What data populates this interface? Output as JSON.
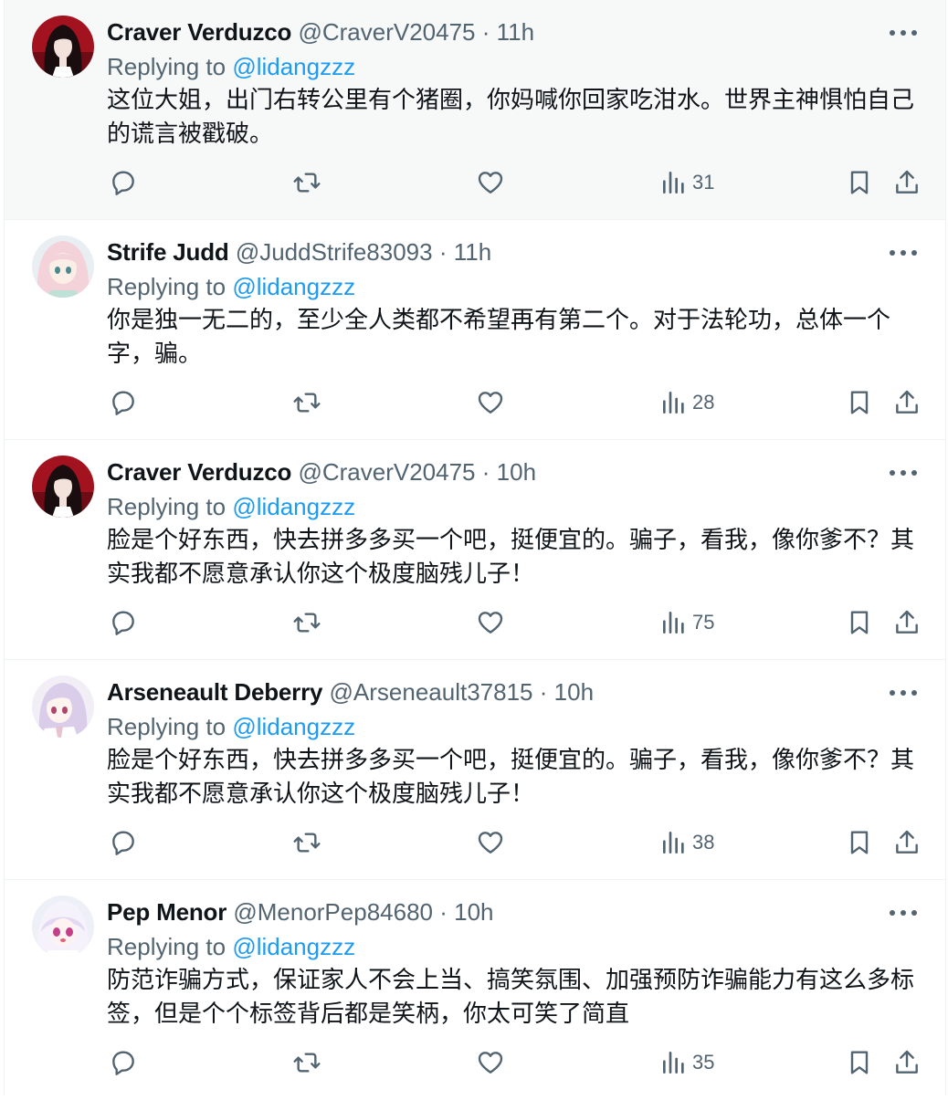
{
  "replying_label": "Replying to",
  "tweets": [
    {
      "name": "Craver Verduzco",
      "handle": "@CraverV20475",
      "separator": "·",
      "time": "11h",
      "mention": "@lidangzzz",
      "text": "这位大姐，出门右转公里有个猪圈，你妈喊你回家吃泔水。世界主神惧怕自己的谎言被戳破。",
      "views": "31",
      "avatar": "dark-hair-red-bg"
    },
    {
      "name": "Strife Judd",
      "handle": "@JuddStrife83093",
      "separator": "·",
      "time": "11h",
      "mention": "@lidangzzz",
      "text": "你是独一无二的，至少全人类都不希望再有第二个。对于法轮功，总体一个字，骗。",
      "views": "28",
      "avatar": "anime-pink-hair"
    },
    {
      "name": "Craver Verduzco",
      "handle": "@CraverV20475",
      "separator": "·",
      "time": "10h",
      "mention": "@lidangzzz",
      "text": "脸是个好东西，快去拼多多买一个吧，挺便宜的。骗子，看我，像你爹不？其实我都不愿意承认你这个极度脑残儿子！",
      "views": "75",
      "avatar": "dark-hair-red-bg"
    },
    {
      "name": "Arseneault Deberry",
      "handle": "@Arseneault37815",
      "separator": "·",
      "time": "10h",
      "mention": "@lidangzzz",
      "text": "脸是个好东西，快去拼多多买一个吧，挺便宜的。骗子，看我，像你爹不？其实我都不愿意承认你这个极度脑残儿子！",
      "views": "38",
      "avatar": "anime-lavender"
    },
    {
      "name": "Pep Menor",
      "handle": "@MenorPep84680",
      "separator": "·",
      "time": "10h",
      "mention": "@lidangzzz",
      "text": "防范诈骗方式，保证家人不会上当、搞笑氛围、加强预防诈骗能力有这么多标签，但是个个标签背后都是笑柄，你太可笑了简直",
      "views": "35",
      "avatar": "anime-white-hair"
    }
  ],
  "icons": {
    "reply": "reply-icon",
    "retweet": "retweet-icon",
    "like": "like-icon",
    "views": "views-icon",
    "bookmark": "bookmark-icon",
    "share": "share-icon",
    "more": "more-icon"
  },
  "colors": {
    "link": "#1d9bf0",
    "secondary_text": "#536471",
    "primary_text": "#0f1419",
    "highlight_bg": "#f7f9f9"
  }
}
